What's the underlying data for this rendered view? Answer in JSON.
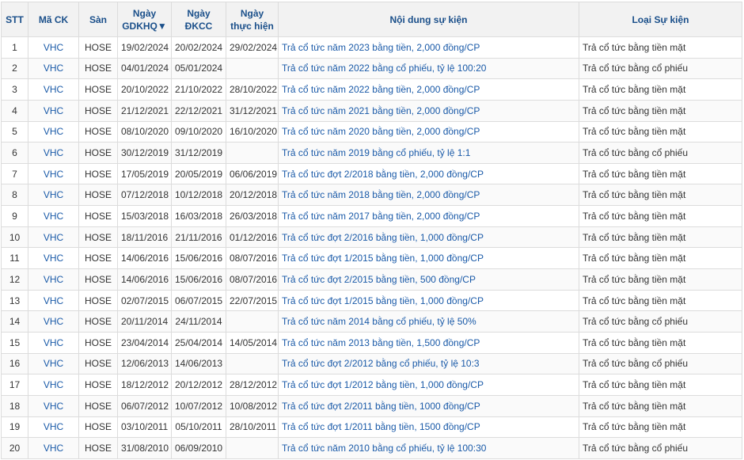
{
  "headers": {
    "stt": "STT",
    "ma_ck": "Mã CK",
    "san": "Sàn",
    "gdkhq": "Ngày GDKHQ▼",
    "dkcc": "Ngày ĐKCC",
    "thuc_hien": "Ngày thực hiện",
    "noi_dung": "Nội dung sự kiện",
    "loai": "Loại Sự kiện"
  },
  "rows": [
    {
      "stt": "1",
      "code": "VHC",
      "exchange": "HOSE",
      "gdkhq": "19/02/2024",
      "dkcc": "20/02/2024",
      "exec": "29/02/2024",
      "content": "Trả cổ tức năm 2023 bằng tiền, 2,000 đồng/CP",
      "type": "Trả cổ tức bằng tiền mặt"
    },
    {
      "stt": "2",
      "code": "VHC",
      "exchange": "HOSE",
      "gdkhq": "04/01/2024",
      "dkcc": "05/01/2024",
      "exec": "",
      "content": "Trả cổ tức năm 2022 bằng cổ phiếu, tỷ lệ 100:20",
      "type": "Trả cổ tức bằng cổ phiếu"
    },
    {
      "stt": "3",
      "code": "VHC",
      "exchange": "HOSE",
      "gdkhq": "20/10/2022",
      "dkcc": "21/10/2022",
      "exec": "28/10/2022",
      "content": "Trả cổ tức năm 2022 bằng tiền, 2,000 đồng/CP",
      "type": "Trả cổ tức bằng tiền mặt"
    },
    {
      "stt": "4",
      "code": "VHC",
      "exchange": "HOSE",
      "gdkhq": "21/12/2021",
      "dkcc": "22/12/2021",
      "exec": "31/12/2021",
      "content": "Trả cổ tức năm 2021 bằng tiền, 2,000 đồng/CP",
      "type": "Trả cổ tức bằng tiền mặt"
    },
    {
      "stt": "5",
      "code": "VHC",
      "exchange": "HOSE",
      "gdkhq": "08/10/2020",
      "dkcc": "09/10/2020",
      "exec": "16/10/2020",
      "content": "Trả cổ tức năm 2020 bằng tiền, 2,000 đồng/CP",
      "type": "Trả cổ tức bằng tiền mặt"
    },
    {
      "stt": "6",
      "code": "VHC",
      "exchange": "HOSE",
      "gdkhq": "30/12/2019",
      "dkcc": "31/12/2019",
      "exec": "",
      "content": "Trả cổ tức năm 2019 bằng cổ phiếu, tỷ lệ 1:1",
      "type": "Trả cổ tức bằng cổ phiếu"
    },
    {
      "stt": "7",
      "code": "VHC",
      "exchange": "HOSE",
      "gdkhq": "17/05/2019",
      "dkcc": "20/05/2019",
      "exec": "06/06/2019",
      "content": "Trả cổ tức đợt 2/2018 bằng tiền, 2,000 đồng/CP",
      "type": "Trả cổ tức bằng tiền mặt"
    },
    {
      "stt": "8",
      "code": "VHC",
      "exchange": "HOSE",
      "gdkhq": "07/12/2018",
      "dkcc": "10/12/2018",
      "exec": "20/12/2018",
      "content": "Trả cổ tức năm 2018 bằng tiền, 2,000 đồng/CP",
      "type": "Trả cổ tức bằng tiền mặt"
    },
    {
      "stt": "9",
      "code": "VHC",
      "exchange": "HOSE",
      "gdkhq": "15/03/2018",
      "dkcc": "16/03/2018",
      "exec": "26/03/2018",
      "content": "Trả cổ tức năm 2017 bằng tiền, 2,000 đồng/CP",
      "type": "Trả cổ tức bằng tiền mặt"
    },
    {
      "stt": "10",
      "code": "VHC",
      "exchange": "HOSE",
      "gdkhq": "18/11/2016",
      "dkcc": "21/11/2016",
      "exec": "01/12/2016",
      "content": "Trả cổ tức đợt 2/2016 bằng tiền, 1,000 đồng/CP",
      "type": "Trả cổ tức bằng tiền mặt"
    },
    {
      "stt": "11",
      "code": "VHC",
      "exchange": "HOSE",
      "gdkhq": "14/06/2016",
      "dkcc": "15/06/2016",
      "exec": "08/07/2016",
      "content": "Trả cổ tức đợt 1/2015 bằng tiền, 1,000 đồng/CP",
      "type": "Trả cổ tức bằng tiền mặt"
    },
    {
      "stt": "12",
      "code": "VHC",
      "exchange": "HOSE",
      "gdkhq": "14/06/2016",
      "dkcc": "15/06/2016",
      "exec": "08/07/2016",
      "content": "Trả cổ tức đợt 2/2015 bằng tiền, 500 đồng/CP",
      "type": "Trả cổ tức bằng tiền mặt"
    },
    {
      "stt": "13",
      "code": "VHC",
      "exchange": "HOSE",
      "gdkhq": "02/07/2015",
      "dkcc": "06/07/2015",
      "exec": "22/07/2015",
      "content": "Trả cổ tức đợt 1/2015 bằng tiền, 1,000 đồng/CP",
      "type": "Trả cổ tức bằng tiền mặt"
    },
    {
      "stt": "14",
      "code": "VHC",
      "exchange": "HOSE",
      "gdkhq": "20/11/2014",
      "dkcc": "24/11/2014",
      "exec": "",
      "content": "Trả cổ tức năm 2014 bằng cổ phiếu, tỷ lệ 50%",
      "type": "Trả cổ tức bằng cổ phiếu"
    },
    {
      "stt": "15",
      "code": "VHC",
      "exchange": "HOSE",
      "gdkhq": "23/04/2014",
      "dkcc": "25/04/2014",
      "exec": "14/05/2014",
      "content": "Trả cổ tức năm 2013 bằng tiền, 1,500 đồng/CP",
      "type": "Trả cổ tức bằng tiền mặt"
    },
    {
      "stt": "16",
      "code": "VHC",
      "exchange": "HOSE",
      "gdkhq": "12/06/2013",
      "dkcc": "14/06/2013",
      "exec": "",
      "content": "Trả cổ tức đợt 2/2012 bằng cổ phiếu, tỷ lệ 10:3",
      "type": "Trả cổ tức bằng cổ phiếu"
    },
    {
      "stt": "17",
      "code": "VHC",
      "exchange": "HOSE",
      "gdkhq": "18/12/2012",
      "dkcc": "20/12/2012",
      "exec": "28/12/2012",
      "content": "Trả cổ tức đợt 1/2012 bằng tiền, 1,000 đồng/CP",
      "type": "Trả cổ tức bằng tiền mặt"
    },
    {
      "stt": "18",
      "code": "VHC",
      "exchange": "HOSE",
      "gdkhq": "06/07/2012",
      "dkcc": "10/07/2012",
      "exec": "10/08/2012",
      "content": "Trả cổ tức đợt 2/2011 bằng tiền, 1000 đồng/CP",
      "type": "Trả cổ tức bằng tiền mặt"
    },
    {
      "stt": "19",
      "code": "VHC",
      "exchange": "HOSE",
      "gdkhq": "03/10/2011",
      "dkcc": "05/10/2011",
      "exec": "28/10/2011",
      "content": "Trả cổ tức đợt 1/2011 bằng tiền, 1500 đồng/CP",
      "type": "Trả cổ tức bằng tiền mặt"
    },
    {
      "stt": "20",
      "code": "VHC",
      "exchange": "HOSE",
      "gdkhq": "31/08/2010",
      "dkcc": "06/09/2010",
      "exec": "",
      "content": "Trả cổ tức năm 2010 bằng cổ phiếu, tỷ lệ 100:30",
      "type": "Trả cổ tức bằng cổ phiếu"
    }
  ]
}
